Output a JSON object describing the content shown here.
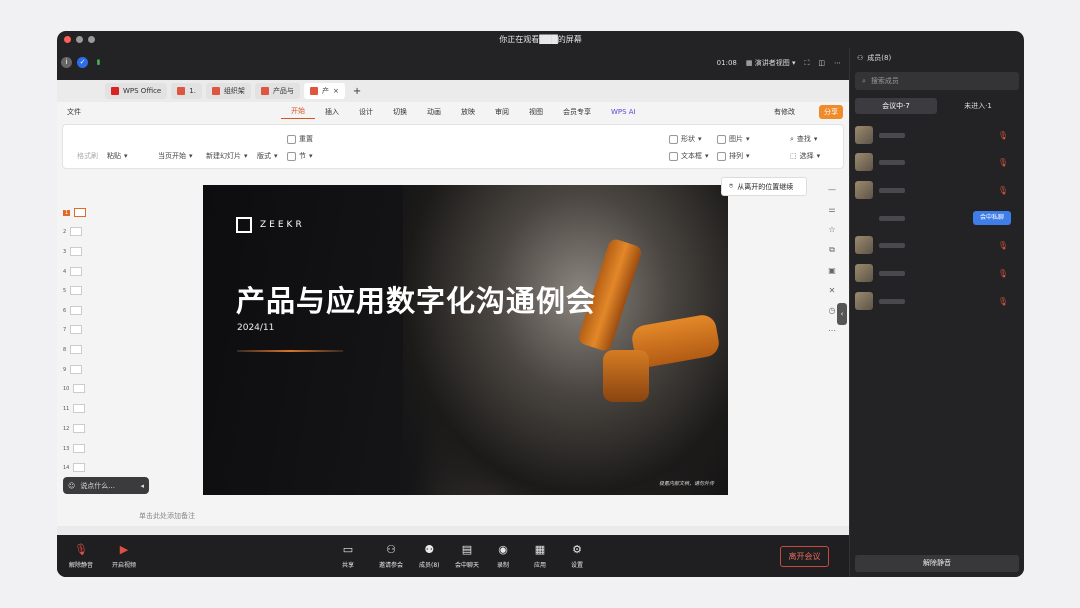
{
  "window_title": "你正在观看███的屏幕",
  "topbar": {
    "time": "01:08",
    "view_mode": "演讲者视图"
  },
  "wps": {
    "tabs": [
      {
        "label": "WPS Office"
      },
      {
        "label": "1."
      },
      {
        "label": "组织架"
      },
      {
        "label": "产品与"
      },
      {
        "label": "产"
      }
    ],
    "menu": [
      "文件",
      "开始",
      "插入",
      "设计",
      "切换",
      "动画",
      "放映",
      "审阅",
      "视图",
      "会员专享",
      "WPS AI"
    ],
    "edit_label": "有修改",
    "share_label": "分享",
    "ribbon": {
      "format_painter": "格式刷",
      "paste": "粘贴",
      "from_current": "当页开始",
      "new_slide": "新建幻灯片",
      "layout": "版式",
      "reset": "重置",
      "section": "节",
      "shape": "形状",
      "picture": "图片",
      "textbox": "文本框",
      "arrange": "排列",
      "find": "查找",
      "select": "选择"
    },
    "resume_label": "从离开的位置继续",
    "slide_numbers": [
      "1",
      "2",
      "3",
      "4",
      "5",
      "6",
      "7",
      "8",
      "9",
      "10",
      "11",
      "12",
      "13",
      "14"
    ],
    "note_placeholder": "单击此处添加备注",
    "chat_placeholder": "说点什么..."
  },
  "slide": {
    "brand": "ZEEKR",
    "title": "产品与应用数字化沟通例会",
    "date": "2024/11",
    "footer": "极氪内部文档，请勿外传"
  },
  "meeting_bar": {
    "unmute": "解除静音",
    "start_video": "开启视频",
    "share": "共享",
    "invite": "邀请参会",
    "members": "成员(8)",
    "chat": "会中聊天",
    "record": "录制",
    "apps": "应用",
    "settings": "设置",
    "leave": "离开会议"
  },
  "sidebar": {
    "title": "成员(8)",
    "search_placeholder": "搜索成员",
    "tab_in_meeting": "会议中·7",
    "tab_not_joined": "未进入·1",
    "private_chat_badge": "会中私聊",
    "unmute_all": "解除静音"
  }
}
